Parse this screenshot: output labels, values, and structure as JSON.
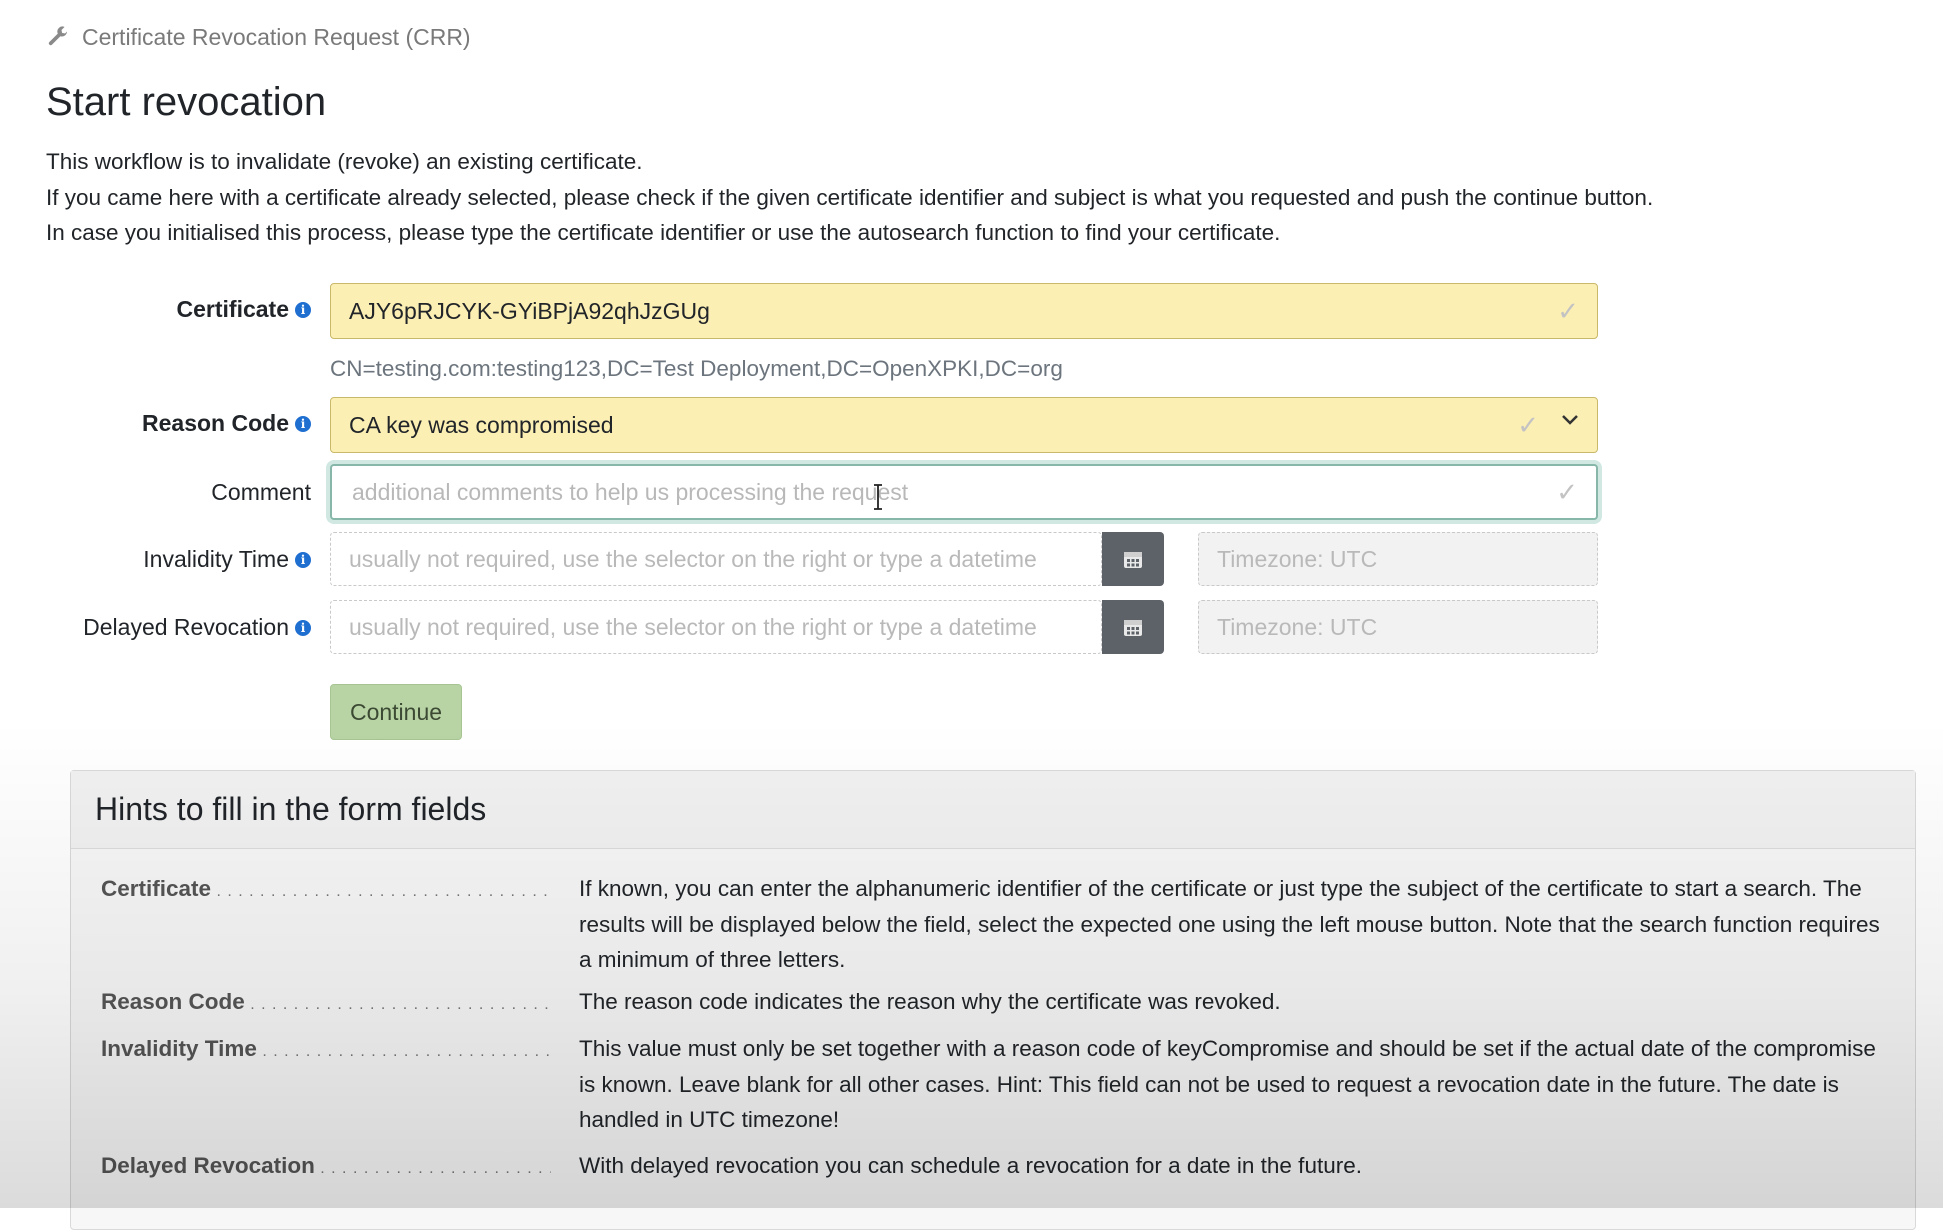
{
  "breadcrumb": {
    "icon": "wrench-icon",
    "label": "Certificate Revocation Request (CRR)"
  },
  "page_title": "Start revocation",
  "intro": [
    "This workflow is to invalidate (revoke) an existing certificate.",
    "If you came here with a certificate already selected, please check if the given certificate identifier and subject is what you requested and push the continue button.",
    "In case you initialised this process, please type the certificate identifier or use the autosearch function to find your certificate."
  ],
  "form": {
    "certificate": {
      "label": "Certificate",
      "value": "AJY6pRJCYK-GYiBPjA92qhJzGUg",
      "subject": "CN=testing.com:testing123,DC=Test Deployment,DC=OpenXPKI,DC=org"
    },
    "reason_code": {
      "label": "Reason Code",
      "value": "CA key was compromised"
    },
    "comment": {
      "label": "Comment",
      "value": "",
      "placeholder": "additional comments to help us processing the request"
    },
    "invalidity_time": {
      "label": "Invalidity Time",
      "placeholder": "usually not required, use the selector on the right or type a datetime",
      "timezone": "Timezone: UTC"
    },
    "delayed_revocation": {
      "label": "Delayed Revocation",
      "placeholder": "usually not required, use the selector on the right or type a datetime",
      "timezone": "Timezone: UTC"
    },
    "continue_label": "Continue"
  },
  "hints": {
    "title": "Hints to fill in the form fields",
    "items": [
      {
        "term": "Certificate",
        "description": "If known, you can enter the alphanumeric identifier of the certificate or just type the subject of the certificate to start a search. The results will be displayed below the field, select the expected one using the left mouse button. Note that the search function requires a minimum of three letters."
      },
      {
        "term": "Reason Code",
        "description": "The reason code indicates the reason why the certificate was revoked."
      },
      {
        "term": "Invalidity Time",
        "description": "This value must only be set together with a reason code of keyCompromise and should be set if the actual date of the compromise is known. Leave blank for all other cases. Hint: This field can not be used to request a revocation date in the future. The date is handled in UTC timezone!"
      },
      {
        "term": "Delayed Revocation",
        "description": "With delayed revocation you can schedule a revocation for a date in the future."
      }
    ]
  },
  "colors": {
    "filled_field": "#fcefb4",
    "continue_button": "#b8d4a4",
    "info_icon": "#1f6fd1",
    "calendar_button": "#5d6268"
  }
}
